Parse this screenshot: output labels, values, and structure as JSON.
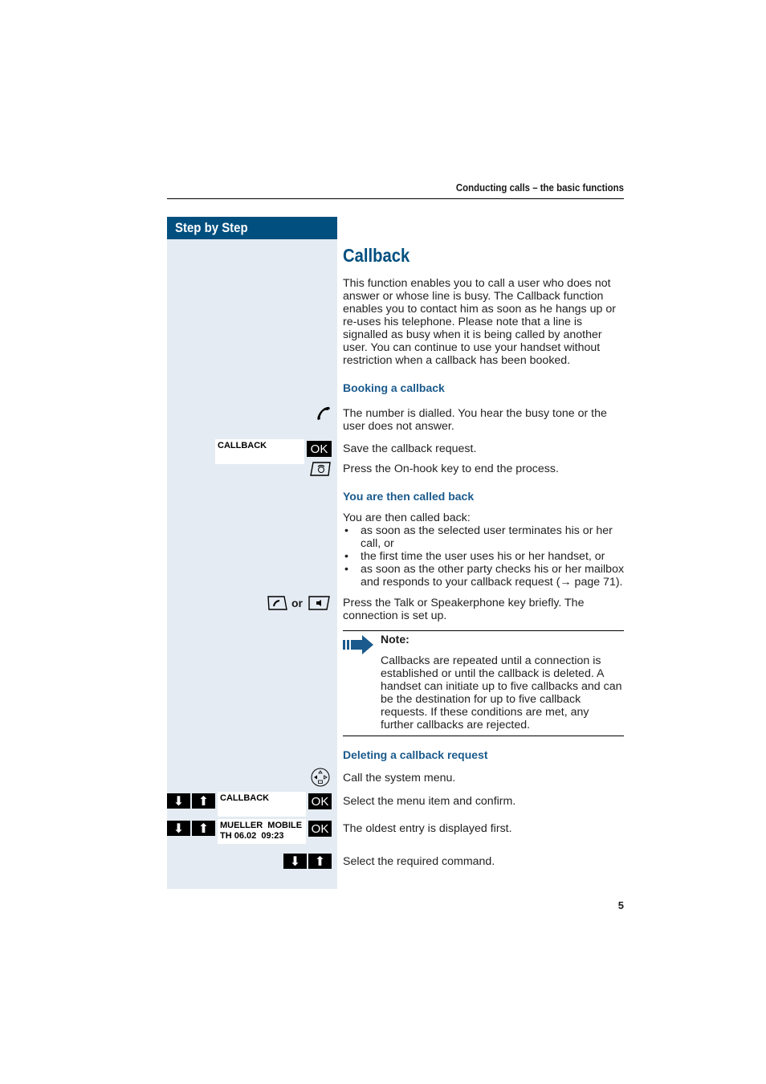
{
  "header": {
    "running_title": "Conducting calls – the basic functions"
  },
  "sidebar": {
    "title": "Step by Step"
  },
  "main": {
    "title": "Callback",
    "intro": "This function enables you to call a user who does not answer or whose line is busy. The Callback function enables you to contact him as soon as he hangs up or re-uses his telephone. Please note that a line is signalled as busy when it is being called by another user. You can continue to use your handset without restriction when a callback has been booked.",
    "booking": {
      "heading": "Booking a callback",
      "steps": [
        {
          "text": "The number is dialled. You hear the busy tone or the user does not answer.",
          "icon": "handset-icon"
        },
        {
          "text": "Save the callback request.",
          "display": "CALLBACK",
          "key": "OK"
        },
        {
          "text": "Press the On-hook key to end the process.",
          "icon": "on-hook-key-icon"
        }
      ]
    },
    "called_back": {
      "heading": "You are then called back",
      "lead": "You are then called back:",
      "bullets": [
        "as soon as the selected user terminates his or her call, or",
        "the first time the user uses his or her handset, or",
        "as soon as the other party checks his or her mailbox and responds to your callback request (→ page 71)."
      ],
      "step": {
        "text": "Press the Talk or Speakerphone key briefly. The connection is set up.",
        "or_label": "or"
      }
    },
    "note": {
      "label": "Note:",
      "text": "Callbacks are repeated until a connection is established or until the callback is deleted. A handset can initiate up to five callbacks and can be the destination for up to five callback requests. If these conditions are met, any further callbacks are rejected."
    },
    "deleting": {
      "heading": "Deleting a callback request",
      "steps": [
        {
          "text": "Call the system menu.",
          "icon": "navigation-key-icon"
        },
        {
          "text": "Select the menu item and confirm.",
          "display": "CALLBACK",
          "key": "OK"
        },
        {
          "text": "The oldest entry is displayed first.",
          "display_line1": "MUELLER  MOBILE",
          "display_line2": "TH 06.02  09:23",
          "key": "OK"
        },
        {
          "text": "Select the required command."
        }
      ]
    }
  },
  "footer": {
    "page_number": "5"
  }
}
